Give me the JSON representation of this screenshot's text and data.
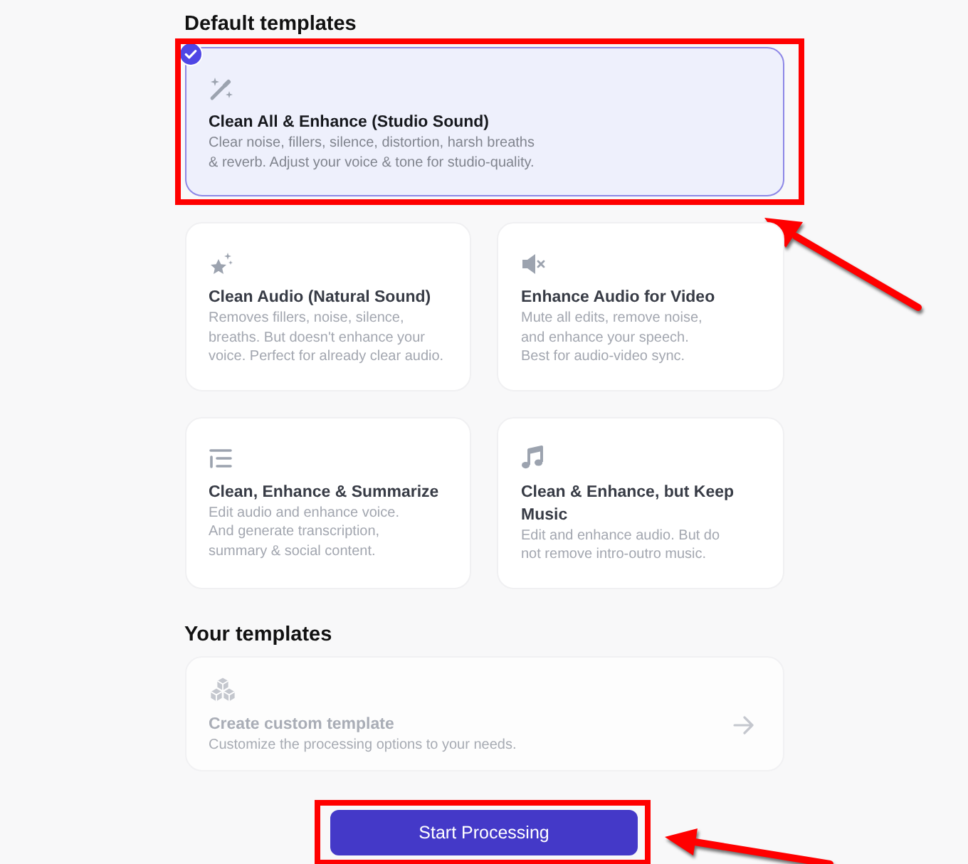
{
  "sections": [
    {
      "kind": "default",
      "heading": "Default templates",
      "templates": [
        {
          "title": "Clean All & Enhance (Studio Sound)",
          "description": "Clear noise, fillers, silence, distortion, harsh breaths\n& reverb. Adjust your voice & tone for studio-quality.",
          "selected": true,
          "highlighted": true
        },
        {
          "title": "Clean Audio (Natural Sound)",
          "description": "Removes fillers, noise, silence,\nbreaths. But doesn't enhance your\nvoice. Perfect for already clear audio.",
          "selected": false,
          "highlighted": false
        },
        {
          "title": "Enhance Audio for Video",
          "description": "Mute all edits, remove noise,\nand enhance your speech.\nBest for audio-video sync.",
          "selected": false,
          "highlighted": false
        },
        {
          "title": "Clean, Enhance & Summarize",
          "description": "Edit audio and enhance voice.\nAnd generate transcription,\nsummary & social content.",
          "selected": false,
          "highlighted": false
        },
        {
          "title": "Clean & Enhance, but Keep Music",
          "description": "Edit and enhance audio. But do\nnot remove intro-outro music.",
          "selected": false,
          "highlighted": false
        }
      ]
    },
    {
      "kind": "custom",
      "heading": "Your templates",
      "create_card": {
        "title": "Create custom template",
        "description": "Customize the processing options to your needs.",
        "disabled": true
      }
    }
  ],
  "start_button": {
    "label": "Start Processing",
    "highlighted": true
  }
}
